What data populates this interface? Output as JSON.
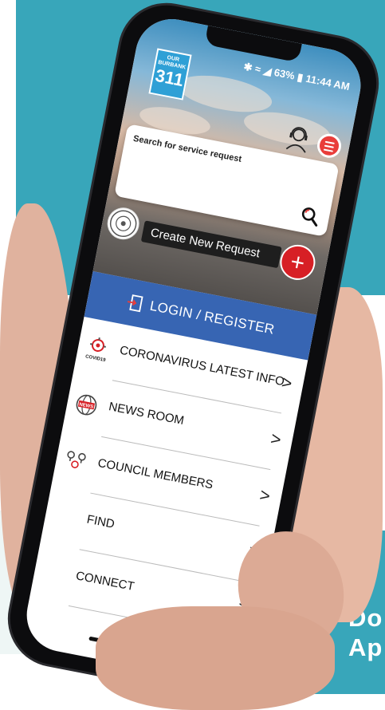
{
  "status_bar": {
    "battery": "63%",
    "time": "11:44 AM"
  },
  "logo": {
    "line1": "OUR",
    "line2": "BURBANK",
    "number": "311"
  },
  "search": {
    "placeholder": "Search for service request"
  },
  "create_request": {
    "label": "Create New Request",
    "fab_symbol": "+"
  },
  "login": {
    "label": "LOGIN / REGISTER"
  },
  "menu": {
    "covid_badge": "COVID19",
    "news_badge": "NEWS",
    "items": [
      {
        "label": "CORONAVIRUS LATEST INFO",
        "icon": "covid-icon"
      },
      {
        "label": "NEWS ROOM",
        "icon": "news-globe-icon"
      },
      {
        "label": "COUNCIL MEMBERS",
        "icon": "council-icon"
      },
      {
        "label": "FIND",
        "icon": ""
      },
      {
        "label": "CONNECT",
        "icon": ""
      }
    ],
    "chevron": ">"
  },
  "promo": {
    "line1": "Do",
    "line2": "Ap"
  },
  "colors": {
    "teal": "#38a6ba",
    "login_blue": "#3765b3",
    "fab_red": "#d71f25",
    "menu_red": "#e93d3a"
  }
}
